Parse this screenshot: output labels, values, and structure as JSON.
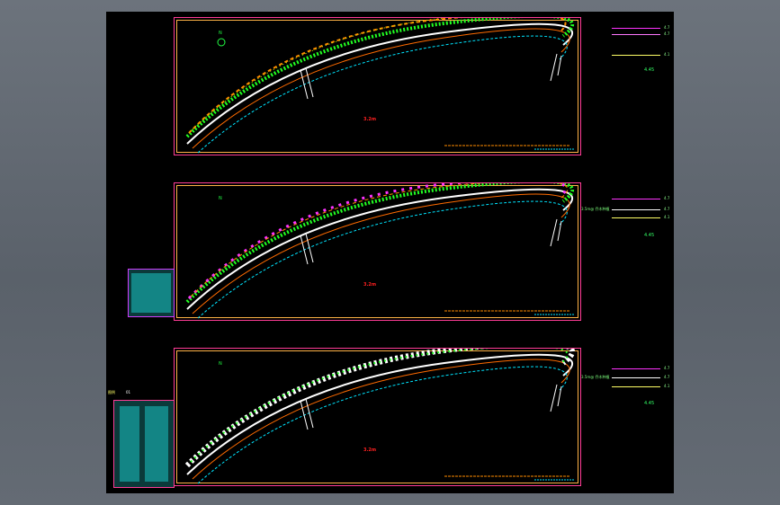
{
  "drawing": {
    "sheets": [
      {
        "id": "sheet-1",
        "scale_text": "4.45",
        "center_tag": "3.2m",
        "legend_values": [
          "4.7",
          "4.7",
          "4.1"
        ]
      },
      {
        "id": "sheet-2",
        "scale_text": "4.45",
        "center_tag": "3.2m",
        "side_text": "3.5m@ 乔木种植",
        "legend_values": [
          "4.7",
          "4.7",
          "4.1"
        ]
      },
      {
        "id": "sheet-3",
        "scale_text": "4.45",
        "center_tag": "3.2m",
        "side_text": "3.5m@ 乔木种植",
        "legend_values": [
          "4.7",
          "4.7",
          "4.1"
        ]
      }
    ],
    "block_label": "图例",
    "block_tag": "01",
    "colors": {
      "background_model": "#000000",
      "frame_outer": "#ff3c96",
      "frame_inner": "#ffb347",
      "road": "#ffffff",
      "kerb": "#00e5ff",
      "planting_green": "#22ff22",
      "planting_orange": "#ff8c00",
      "planting_magenta": "#ff33ff",
      "table_fill": "#138585"
    }
  }
}
